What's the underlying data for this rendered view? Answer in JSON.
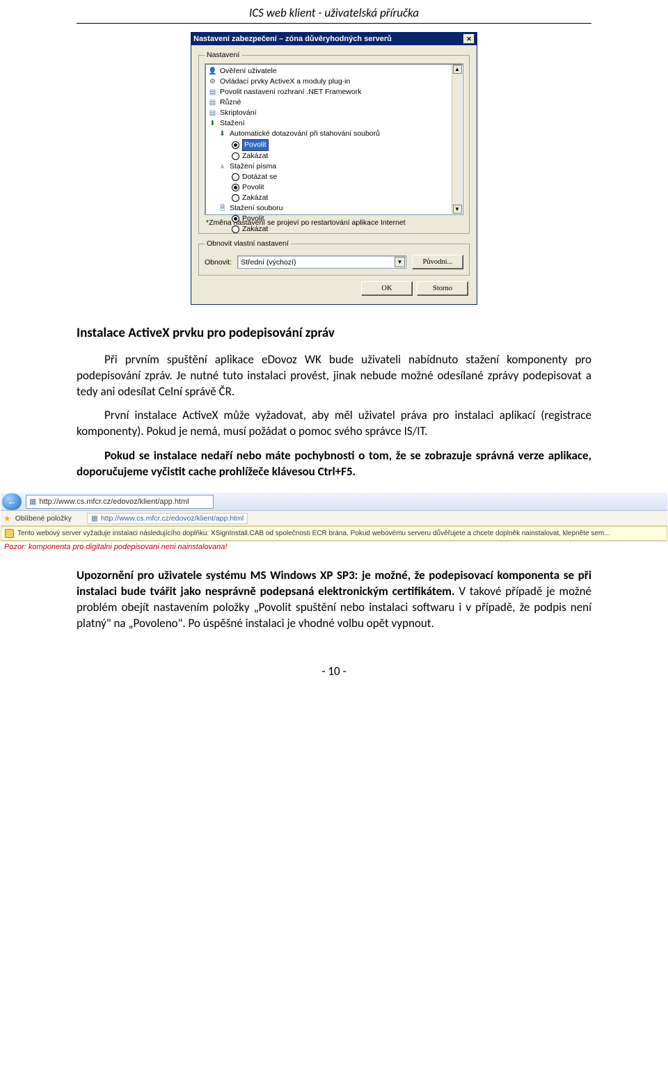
{
  "header": "ICS web klient - uživatelská příručka",
  "dialog": {
    "title": "Nastavení zabezpečení – zóna důvěryhodných serverů",
    "group_settings": "Nastavení",
    "tree": {
      "items": [
        {
          "depth": 0,
          "icon": "user",
          "label": "Ověření uživatele"
        },
        {
          "depth": 0,
          "icon": "gear",
          "label": "Ovládací prvky ActiveX a moduly plug-in"
        },
        {
          "depth": 0,
          "icon": "page",
          "label": "Povolit nastavení rozhraní .NET Framework"
        },
        {
          "depth": 0,
          "icon": "page",
          "label": "Různé"
        },
        {
          "depth": 0,
          "icon": "page",
          "label": "Skriptování"
        },
        {
          "depth": 0,
          "icon": "down",
          "label": "Stažení"
        },
        {
          "depth": 1,
          "icon": "down",
          "label": "Automatické dotazování při stahování souborů"
        },
        {
          "depth": 2,
          "radio": true,
          "selected": true,
          "label": "Povolit"
        },
        {
          "depth": 2,
          "radio": false,
          "label": "Zakázat"
        },
        {
          "depth": 1,
          "icon": "font",
          "label": "Stažení písma"
        },
        {
          "depth": 2,
          "radio": false,
          "label": "Dotázat se"
        },
        {
          "depth": 2,
          "radio": true,
          "label": "Povolit"
        },
        {
          "depth": 2,
          "radio": false,
          "label": "Zakázat"
        },
        {
          "depth": 1,
          "icon": "file",
          "label": "Stažení souboru"
        },
        {
          "depth": 2,
          "radio": true,
          "label": "Povolit"
        },
        {
          "depth": 2,
          "radio": false,
          "label": "Zakázat"
        }
      ],
      "note": "*Změna nastavení se projeví po restartování aplikace Internet"
    },
    "group_reset": "Obnovit vlastní nastavení",
    "reset_label": "Obnovit:",
    "reset_option": "Střední (výchozí)",
    "reset_button": "Původní...",
    "ok": "OK",
    "cancel": "Storno"
  },
  "doc": {
    "heading": "Instalace ActiveX prvku pro podepisování zpráv",
    "p1": "Při prvním spuštění aplikace eDovoz WK bude uživateli nabídnuto stažení komponenty pro podepisování zpráv. Je nutné tuto instalaci provést, jinak nebude možné odesílané zprávy podepisovat a tedy ani odesílat Celní správě ČR.",
    "p2": "První instalace ActiveX může vyžadovat, aby měl uživatel práva pro instalaci aplikací (registrace komponenty). Pokud je nemá, musí požádat o pomoc svého správce IS/IT.",
    "p3": "Pokud se instalace nedaří nebo máte pochybnosti o tom, že se zobrazuje správná verze aplikace, doporučujeme vyčistit cache prohlížeče klávesou Ctrl+F5.",
    "p4a": "Upozornění pro uživatele systému MS Windows XP SP3: je možné, že podepisovací komponenta se při instalaci bude tvářit jako nesprávně podepsaná elektronickým certifikátem.",
    "p4b": " V takové případě je možné problém obejít nastavením položky „Povolit spuštění nebo instalaci softwaru i v případě, že podpis není platný\" na „Povoleno\". Po úspěšné instalaci je vhodné volbu opět vypnout."
  },
  "ie": {
    "url": "http://www.cs.mfcr.cz/edovoz/klient/app.html",
    "fav_label": "Oblíbené položky",
    "fav_link": "http://www.cs.mfcr.cz/edovoz/klient/app.html",
    "infobar": "Tento webový server vyžaduje instalaci následujícího doplňku: XSignInstall.CAB od společnosti ECR brána. Pokud webovému serveru důvěřujete a chcete doplněk nainstalovat, klepněte sem...",
    "warn": "Pozor: komponenta pro digitalni podepisovani neni nainstalovana!"
  },
  "footer": "- 10 -"
}
